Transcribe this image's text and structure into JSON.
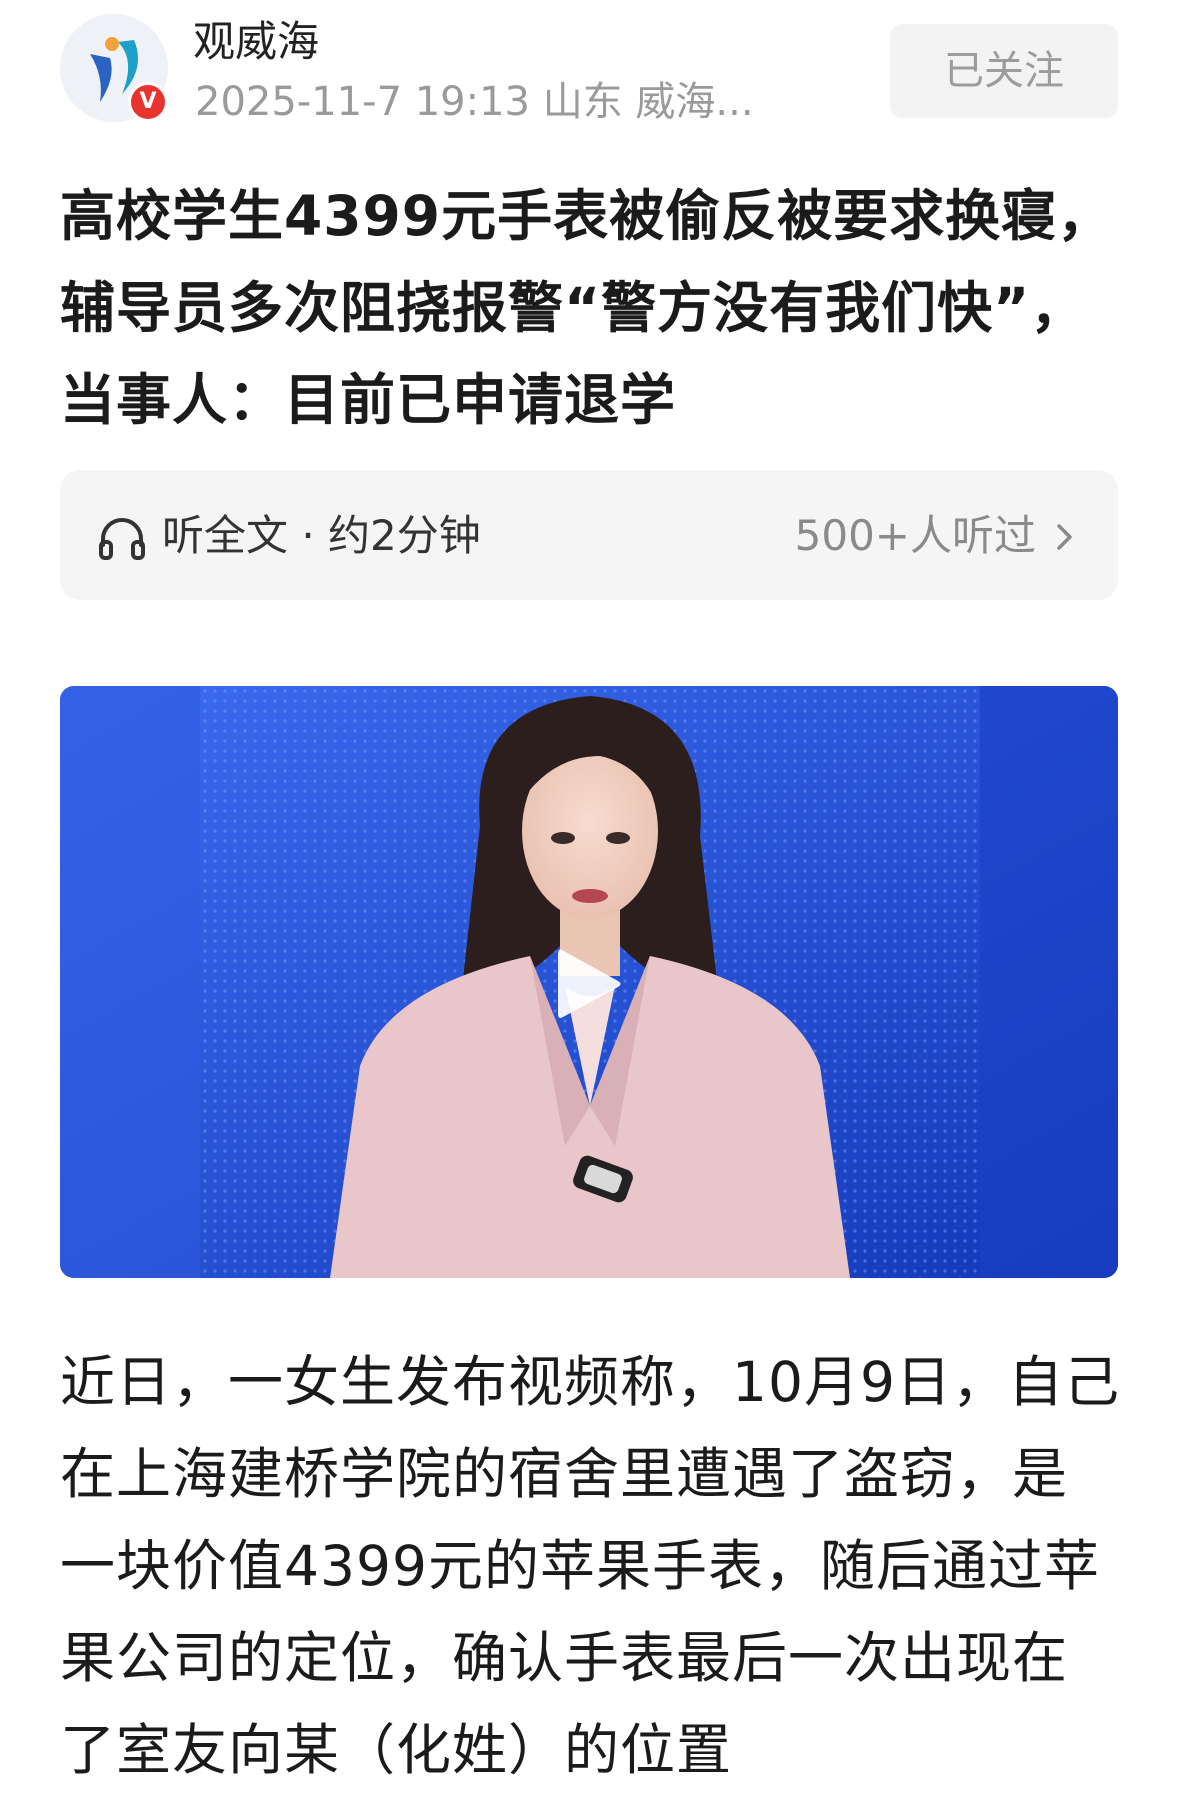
{
  "header": {
    "author_name": "观威海",
    "post_meta": "2025-11-7 19:13 山东 威海...",
    "verified_badge": "V",
    "follow_label": "已关注"
  },
  "article": {
    "title": "高校学生4399元手表被偷反被要求换寝，辅导员多次阻挠报警“警方没有我们快”，当事人：目前已申请退学",
    "body": "近日，一女生发布视频称，10月9日，自己在上海建桥学院的宿舍里遭遇了盗窃，是一块价值4399元的苹果手表，随后通过苹果公司的定位，确认手表最后一次出现在了室友向某（化姓）的位置"
  },
  "listen": {
    "label": "听全文 · 约2分钟",
    "count": "500+人听过"
  },
  "video": {
    "thumbnail": "news-anchor-in-pink-suit-on-blue-background",
    "play_icon": "play-icon"
  },
  "colors": {
    "verified_red": "#e8332f",
    "meta_gray": "#9a9a9a",
    "video_blue": "#1f4fd6",
    "suit_pink": "#e9c6c9"
  }
}
